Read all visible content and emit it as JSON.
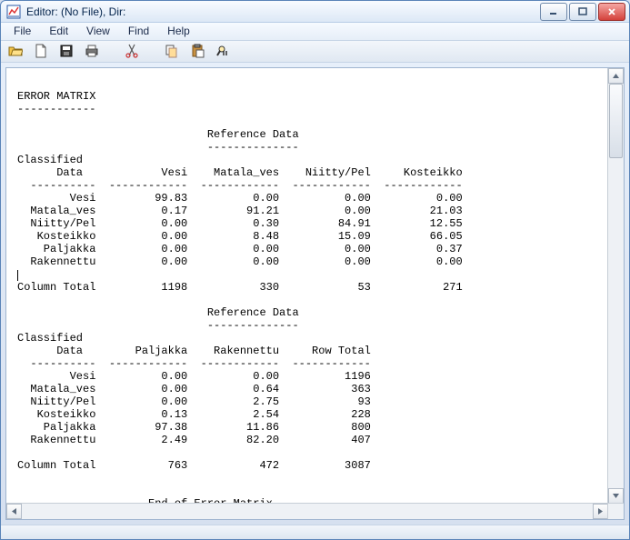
{
  "window": {
    "title": "Editor: (No File), Dir:"
  },
  "menu": {
    "items": [
      "File",
      "Edit",
      "View",
      "Find",
      "Help"
    ]
  },
  "editor": {
    "header_title": "ERROR MATRIX",
    "header_rule": "------------",
    "ref_header": "Reference Data",
    "ref_rule": "--------------",
    "class_header1": "Classified",
    "class_header2": "      Data",
    "section1_columns": [
      "Vesi",
      "Matala_ves",
      "Niitty/Pel",
      "Kosteikko"
    ],
    "section2_columns": [
      "Paljakka",
      "Rakennettu",
      "Row Total"
    ],
    "row_labels": [
      "Vesi",
      "Matala_ves",
      "Niitty/Pel",
      "Kosteikko",
      "Paljakka",
      "Rakennettu"
    ],
    "section1_values": [
      [
        "99.83",
        "0.00",
        "0.00",
        "0.00"
      ],
      [
        "0.17",
        "91.21",
        "0.00",
        "21.03"
      ],
      [
        "0.00",
        "0.30",
        "84.91",
        "12.55"
      ],
      [
        "0.00",
        "8.48",
        "15.09",
        "66.05"
      ],
      [
        "0.00",
        "0.00",
        "0.00",
        "0.37"
      ],
      [
        "0.00",
        "0.00",
        "0.00",
        "0.00"
      ]
    ],
    "section1_totals_label": "Column Total",
    "section1_totals": [
      "1198",
      "330",
      "53",
      "271"
    ],
    "section2_values": [
      [
        "0.00",
        "0.00",
        "1196"
      ],
      [
        "0.00",
        "0.64",
        "363"
      ],
      [
        "0.00",
        "2.75",
        "93"
      ],
      [
        "0.13",
        "2.54",
        "228"
      ],
      [
        "97.38",
        "11.86",
        "800"
      ],
      [
        "2.49",
        "82.20",
        "407"
      ]
    ],
    "section2_totals_label": "Column Total",
    "section2_totals": [
      "763",
      "472",
      "3087"
    ],
    "footer": "----- End of Error Matrix -----"
  }
}
